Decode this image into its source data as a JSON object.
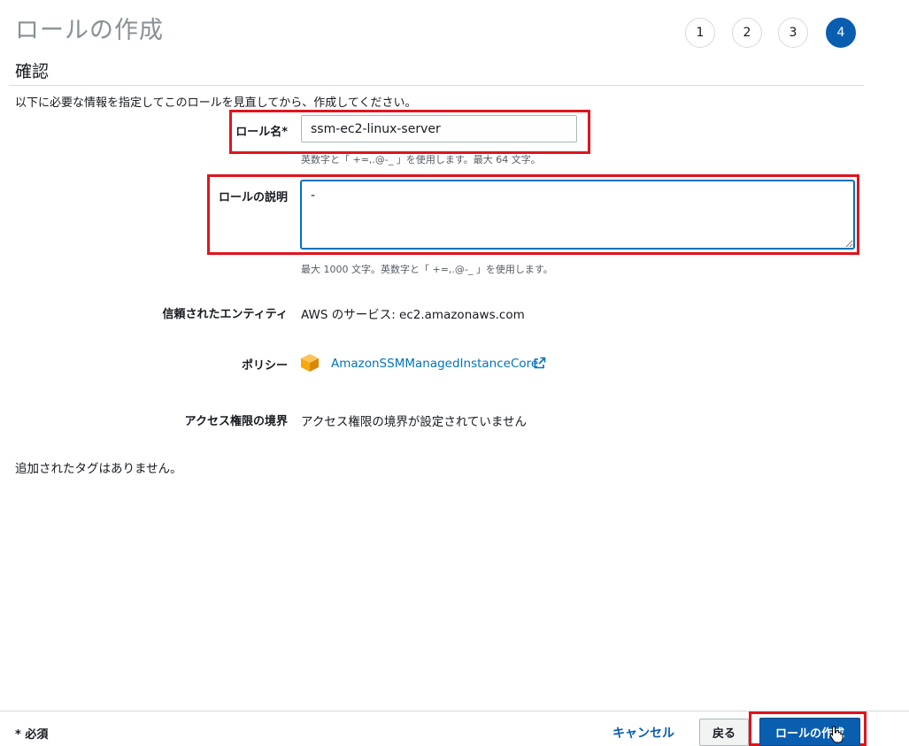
{
  "page": {
    "title": "ロールの作成",
    "steps": [
      "1",
      "2",
      "3",
      "4"
    ],
    "active_step": "4"
  },
  "review": {
    "section_title": "確認",
    "intro": "以下に必要な情報を指定してこのロールを見直してから、作成してください。"
  },
  "role_name": {
    "label": "ロール名*",
    "value": "ssm-ec2-linux-server",
    "hint": "英数字と「 +=,.@-_ 」を使用します。最大 64 文字。"
  },
  "role_description": {
    "label": "ロールの説明",
    "value": "-",
    "hint": "最大 1000 文字。英数字と「 +=,.@-_ 」を使用します。"
  },
  "trusted_entity": {
    "label": "信頼されたエンティティ",
    "value": "AWS のサービス: ec2.amazonaws.com"
  },
  "policy": {
    "label": "ポリシー",
    "name": "AmazonSSMManagedInstanceCore",
    "icon": "aws-managed-policy-cube-icon"
  },
  "permissions_boundary": {
    "label": "アクセス権限の境界",
    "value": "アクセス権限の境界が設定されていません"
  },
  "tags": {
    "message": "追加されたタグはありません。"
  },
  "footer": {
    "required_note": "* 必須",
    "cancel_label": "キャンセル",
    "back_label": "戻る",
    "create_label": "ロールの作成"
  },
  "colors": {
    "primary": "#0a5eb0",
    "link": "#0073bb",
    "highlight": "#e0141e",
    "policy_icon": "#f7a80d"
  }
}
